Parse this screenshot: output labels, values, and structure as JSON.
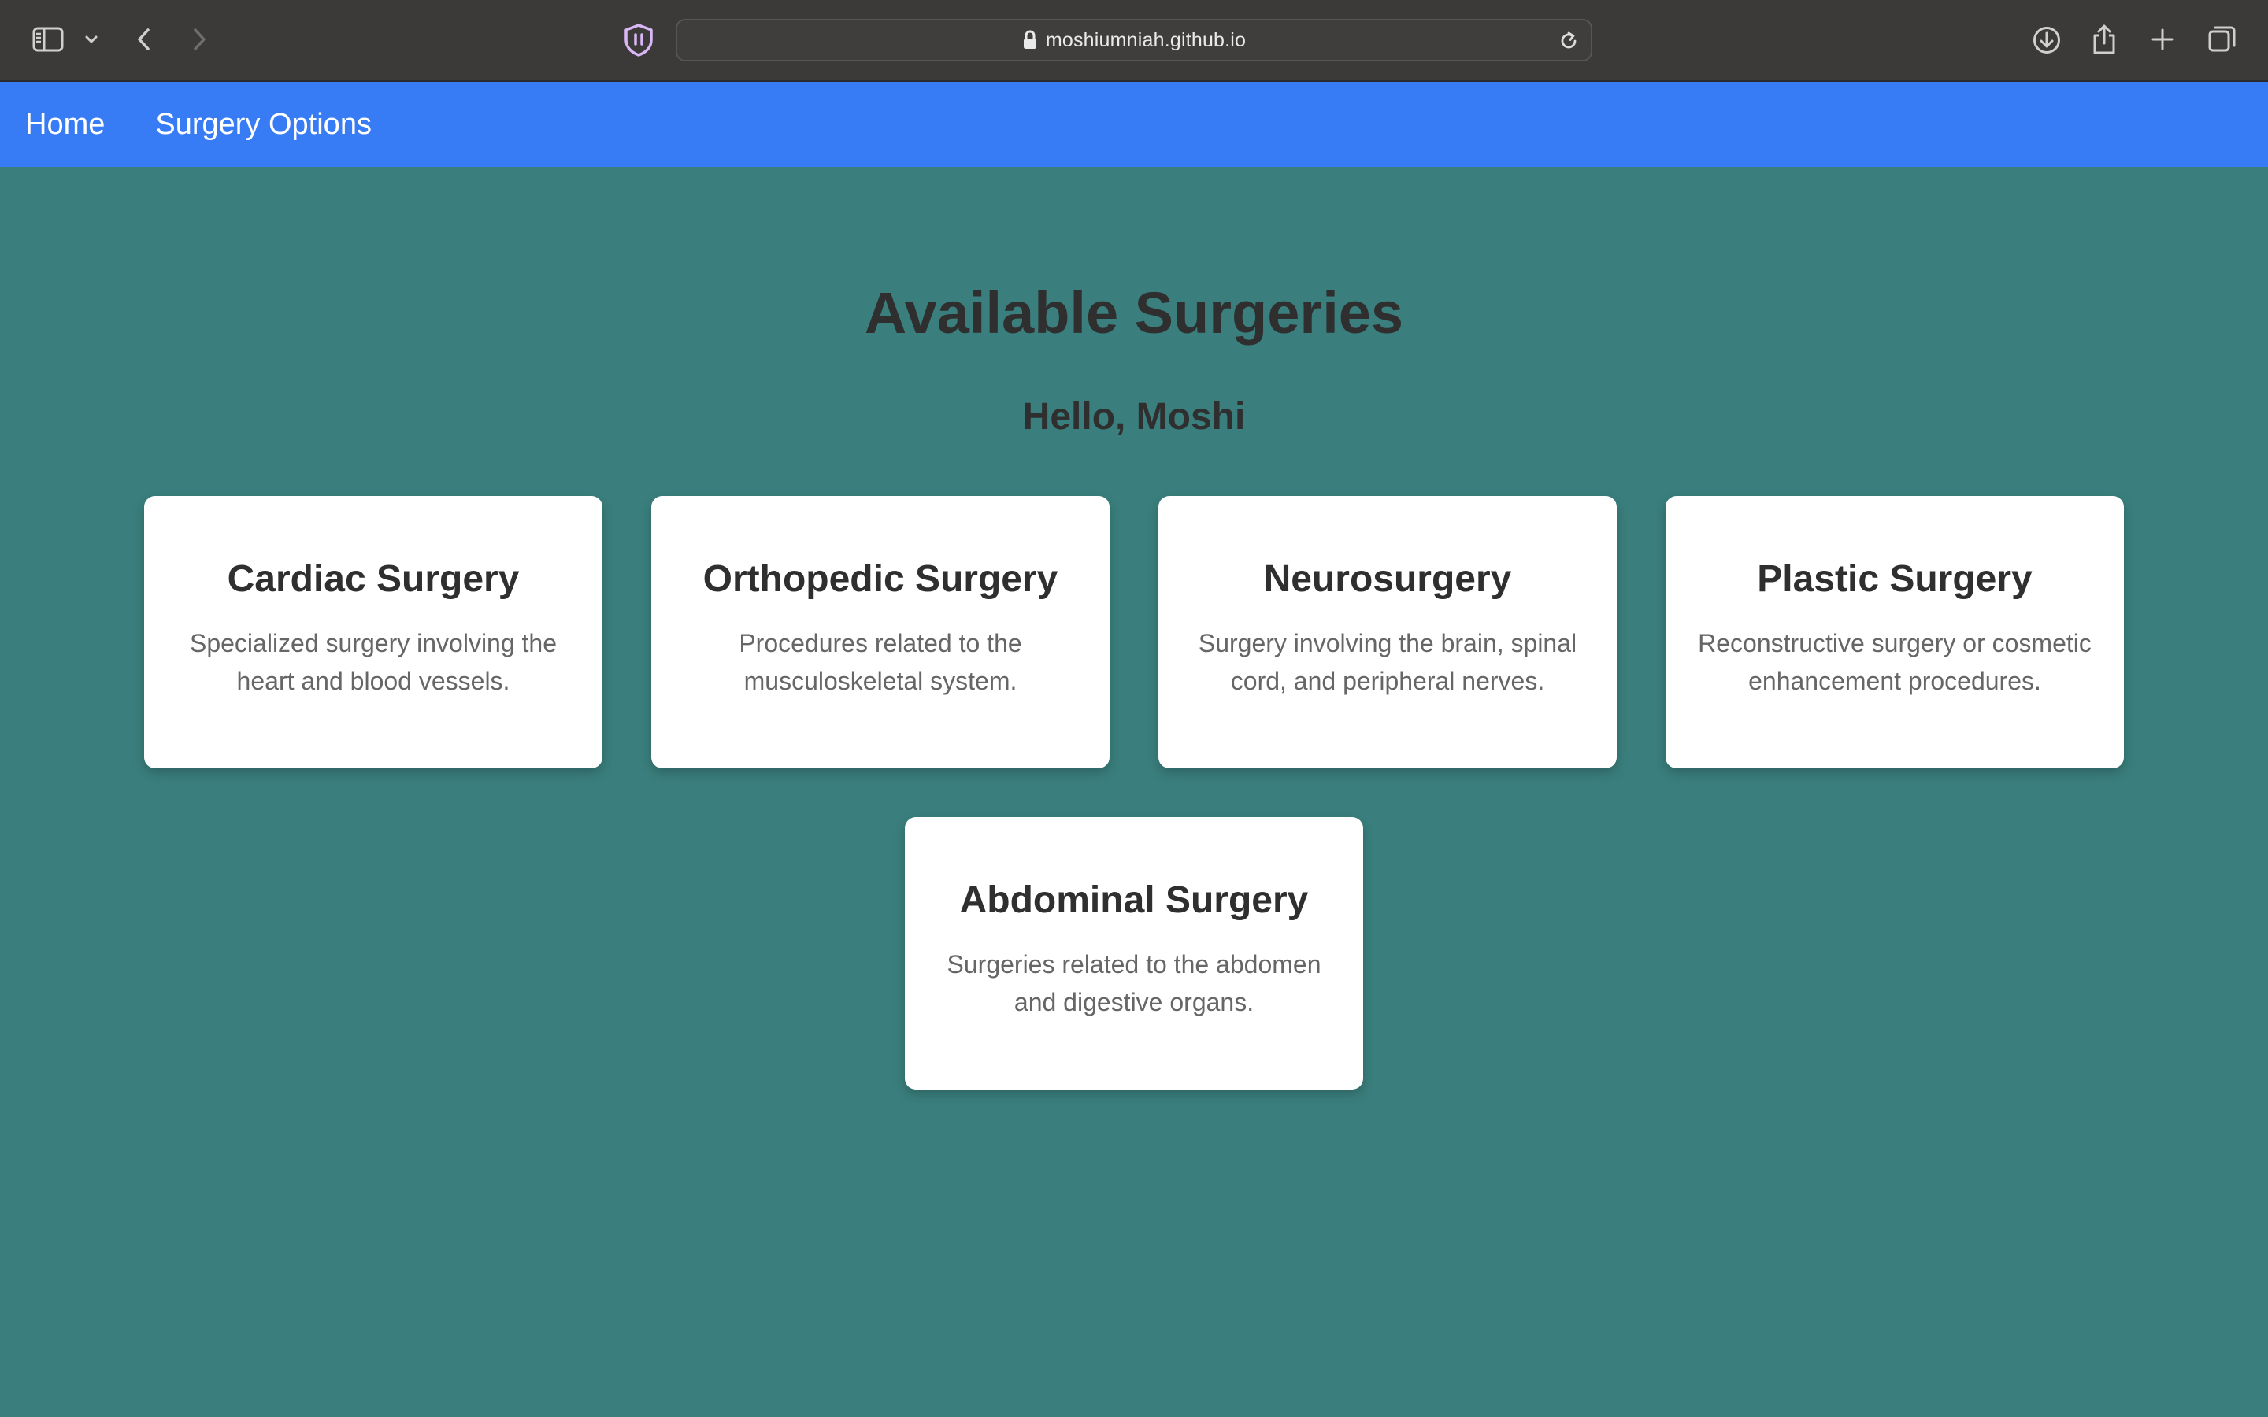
{
  "browser": {
    "url": "moshiumniah.github.io",
    "icons": {
      "sidebar": "sidebar-icon",
      "dropdown": "chevron-down-icon",
      "back": "chevron-left-icon",
      "forward": "chevron-right-icon",
      "shield": "privacy-shield-icon",
      "lock": "lock-icon",
      "reload": "reload-icon",
      "download": "download-icon",
      "share": "share-icon",
      "new_tab": "plus-icon",
      "tabs": "tab-overview-icon"
    }
  },
  "nav": {
    "items": [
      {
        "label": "Home"
      },
      {
        "label": "Surgery Options"
      }
    ],
    "background": "#377bf5"
  },
  "page": {
    "title": "Available Surgeries",
    "greeting": "Hello, Moshi",
    "background": "#3a7f7d"
  },
  "cards": [
    {
      "title": "Cardiac Surgery",
      "description": "Specialized surgery involving the heart and blood vessels."
    },
    {
      "title": "Orthopedic Surgery",
      "description": "Procedures related to the musculoskeletal system."
    },
    {
      "title": "Neurosurgery",
      "description": "Surgery involving the brain, spinal cord, and peripheral nerves."
    },
    {
      "title": "Plastic Surgery",
      "description": "Reconstructive surgery or cosmetic enhancement procedures."
    },
    {
      "title": "Abdominal Surgery",
      "description": "Surgeries related to the abdomen and digestive organs."
    }
  ]
}
